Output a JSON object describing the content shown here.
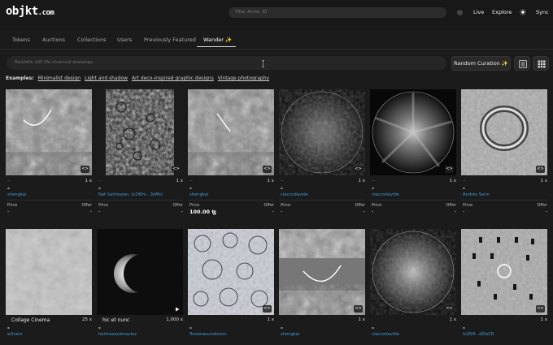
{
  "header": {
    "logo_main": "objkt",
    "logo_suffix": ".com",
    "search_placeholder": "Title, Artist, ID",
    "nav": [
      "Live",
      "Explore",
      "Sync"
    ],
    "sun_icon": "sun-icon"
  },
  "tabs": [
    {
      "label": "Tokens",
      "active": false
    },
    {
      "label": "Auctions",
      "active": false
    },
    {
      "label": "Collections",
      "active": false
    },
    {
      "label": "Users",
      "active": false
    },
    {
      "label": "Previously Featured",
      "active": false
    },
    {
      "label": "Wander ✨",
      "active": true
    }
  ],
  "wander": {
    "placeholder": "Realistic still life charcoal drawings",
    "curation_label": "Random Curation ✨",
    "examples_label": "Examples:",
    "examples": [
      "Minimalist design",
      "Light and shadow",
      "Art deco-inspired graphic designs",
      "Vintage photography"
    ]
  },
  "row1": [
    {
      "title": "-",
      "artist": "shengkai",
      "editions": "1 x",
      "price": "-",
      "offer": "-",
      "badge": "<>",
      "dash": "--"
    },
    {
      "title": "-",
      "artist": "Nat Sarkissian, tz2Wm...3oMvl",
      "editions": "1 x",
      "price": "-",
      "offer": "-",
      "badge": "<>",
      "dash": "--"
    },
    {
      "title": "-",
      "artist": "shengkai",
      "editions": "1 x",
      "price": "100.00 ꜩ",
      "offer": "-",
      "badge": "<>",
      "dash": "--"
    },
    {
      "title": "-",
      "artist": "ciaccodavide",
      "editions": "1 x",
      "price": "-",
      "offer": "-",
      "badge": "<>",
      "dash": "--"
    },
    {
      "title": "-",
      "artist": "ciaccodavide",
      "editions": "1 x",
      "price": "-",
      "offer": "-",
      "badge": "<>",
      "dash": "--"
    },
    {
      "title": "-",
      "artist": "Andrés Senn",
      "editions": "1 x",
      "price": "-",
      "offer": "-",
      "badge": "<>",
      "dash": "--"
    }
  ],
  "row2": [
    {
      "overlay_title": "Collage Cinema",
      "editions": "25 x",
      "title": "-",
      "artist": "w3vers"
    },
    {
      "overlay_title": "hic et nunc",
      "editions": "1,000 x",
      "title": "-",
      "artist": "hermesaversaclez"
    },
    {
      "overlay_title": "",
      "editions": "1 x",
      "title": "-",
      "artist": "flonanasumbrunn",
      "badge": "<>"
    },
    {
      "overlay_title": "",
      "editions": "1 x",
      "title": "-",
      "artist": "shengkai",
      "badge": "<>"
    },
    {
      "overlay_title": "",
      "editions": "1 x",
      "title": "-",
      "artist": "ciaccodavide",
      "badge": "<>"
    },
    {
      "overlay_title": "",
      "editions": "1 x",
      "title": "-",
      "artist": "tz2N4...dZwCR",
      "badge": "<>"
    }
  ],
  "labels": {
    "price": "Price",
    "offer": "Offer"
  },
  "colors": {
    "background": "#1b1b1b",
    "artist_link": "#3a9bd9"
  }
}
